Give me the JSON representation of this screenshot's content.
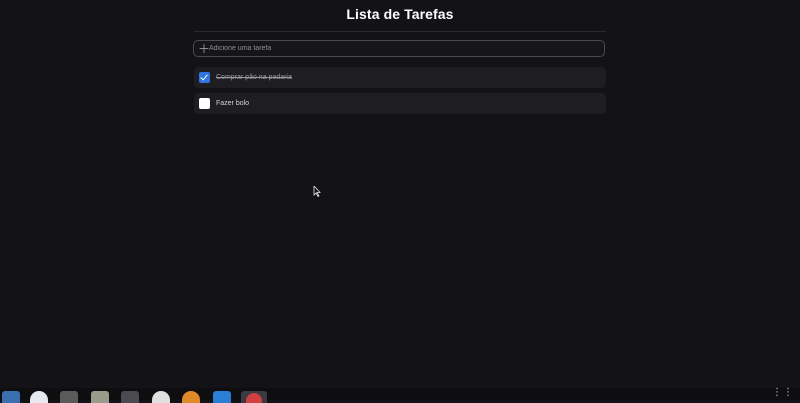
{
  "app": {
    "title": "Lista de Tarefas",
    "add_task": {
      "icon": "plus-icon",
      "placeholder": "Adicione uma tarefa",
      "value": ""
    },
    "tasks": [
      {
        "label": "Comprar pão na padaria",
        "done": true
      },
      {
        "label": "Fazer bolo",
        "done": false
      }
    ]
  },
  "taskbar": {
    "icons": [
      "document-viewer-icon",
      "browser-icon",
      "sublime-text-icon",
      "file-manager-icon",
      "terminal-icon",
      "chrome-icon",
      "firefox-icon",
      "vscode-icon",
      "active-app-icon"
    ],
    "more_label": "⋮⋮"
  },
  "colors": {
    "background": "#131317",
    "task_background": "#1d1d22",
    "accent": "#2f74e0"
  }
}
